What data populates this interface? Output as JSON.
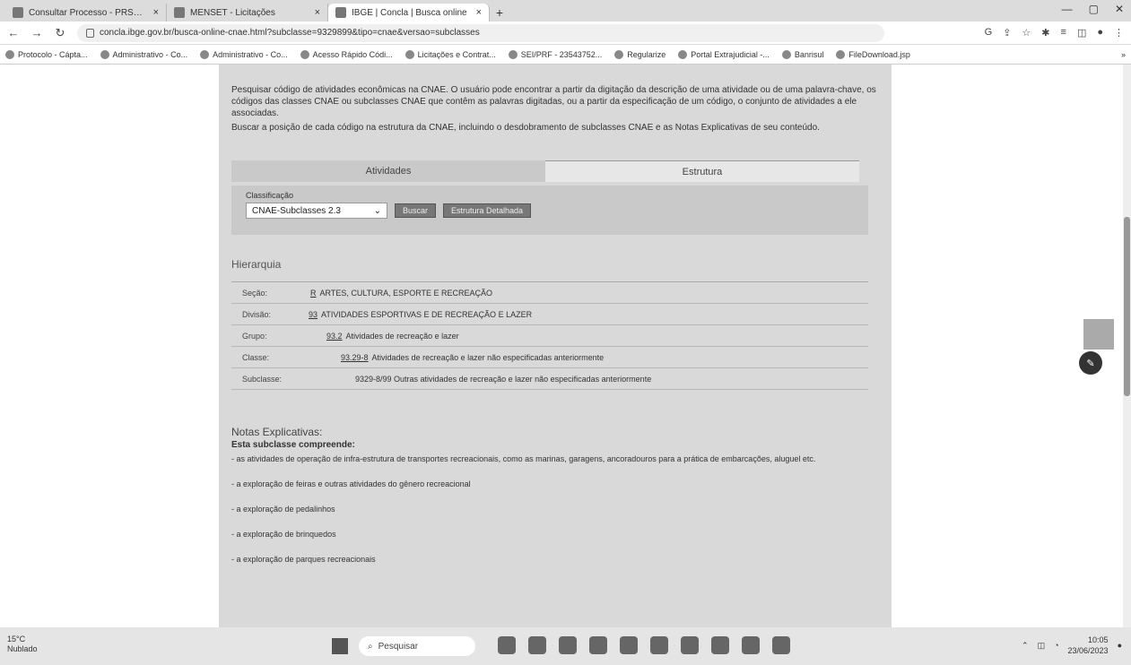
{
  "browser": {
    "tabs": [
      {
        "label": "Consultar Processo - PRSUFT",
        "active": false
      },
      {
        "label": "MENSET - Licitações",
        "active": false
      },
      {
        "label": "IBGE | Concla | Busca online",
        "active": true
      }
    ],
    "new_tab": "+",
    "url": "concla.ibge.gov.br/busca-online-cnae.html?subclasse=9329899&tipo=cnae&versao=subclasses",
    "bookmarks": [
      "Protocolo - Cápta...",
      "Administrativo - Co...",
      "Administrativo - Co...",
      "Acesso Rápido Códi...",
      "Licitações e Contrat...",
      "SEI/PRF - 23543752...",
      "Regularize",
      "Portal Extrajudicial -...",
      "Banrisul",
      "FileDownload.jsp"
    ]
  },
  "intro": {
    "p1": "Pesquisar código de atividades econômicas na CNAE. O usuário pode encontrar a partir da digitação da descrição de uma atividade ou de uma palavra-chave, os códigos das classes CNAE ou subclasses CNAE que contêm as palavras digitadas, ou a partir da especificação de um código, o conjunto de atividades a ele associadas.",
    "p2": "Buscar a posição de cada código na estrutura da CNAE, incluindo o desdobramento de subclasses CNAE e as Notas Explicativas de seu conteúdo."
  },
  "tabs": {
    "atividades": "Atividades",
    "estrutura": "Estrutura"
  },
  "classificacao": {
    "label": "Classificação",
    "selected": "CNAE-Subclasses 2.3",
    "btn_buscar": "Buscar",
    "btn_estrutura": "Estrutura Detalhada"
  },
  "hierarquia": {
    "title": "Hierarquia",
    "rows": [
      {
        "key": "Seção:",
        "code": "R",
        "text": "ARTES, CULTURA, ESPORTE E RECREAÇÃO"
      },
      {
        "key": "Divisão:",
        "code": "93",
        "text": "ATIVIDADES ESPORTIVAS E DE RECREAÇÃO E LAZER"
      },
      {
        "key": "Grupo:",
        "code": "93.2",
        "text": "Atividades de recreação e lazer"
      },
      {
        "key": "Classe:",
        "code": "93.29-8",
        "text": "Atividades de recreação e lazer não especificadas anteriormente"
      },
      {
        "key": "Subclasse:",
        "code": "",
        "text": "9329-8/99 Outras atividades de recreação e lazer não especificadas anteriormente"
      }
    ]
  },
  "notas": {
    "title": "Notas Explicativas:",
    "sub": "Esta subclasse compreende:",
    "items": [
      "- as atividades de operação de infra-estrutura de transportes recreacionais, como as marinas, garagens, ancoradouros para a prática de embarcações, aluguel etc.",
      "- a exploração de feiras e outras atividades do gênero recreacional",
      "- a exploração de pedalinhos",
      "- a exploração de brinquedos",
      "- a exploração de parques recreacionais"
    ]
  },
  "taskbar": {
    "weather_temp": "15°C",
    "weather_desc": "Nublado",
    "search": "Pesquisar",
    "time": "10:05",
    "date": "23/06/2023"
  }
}
